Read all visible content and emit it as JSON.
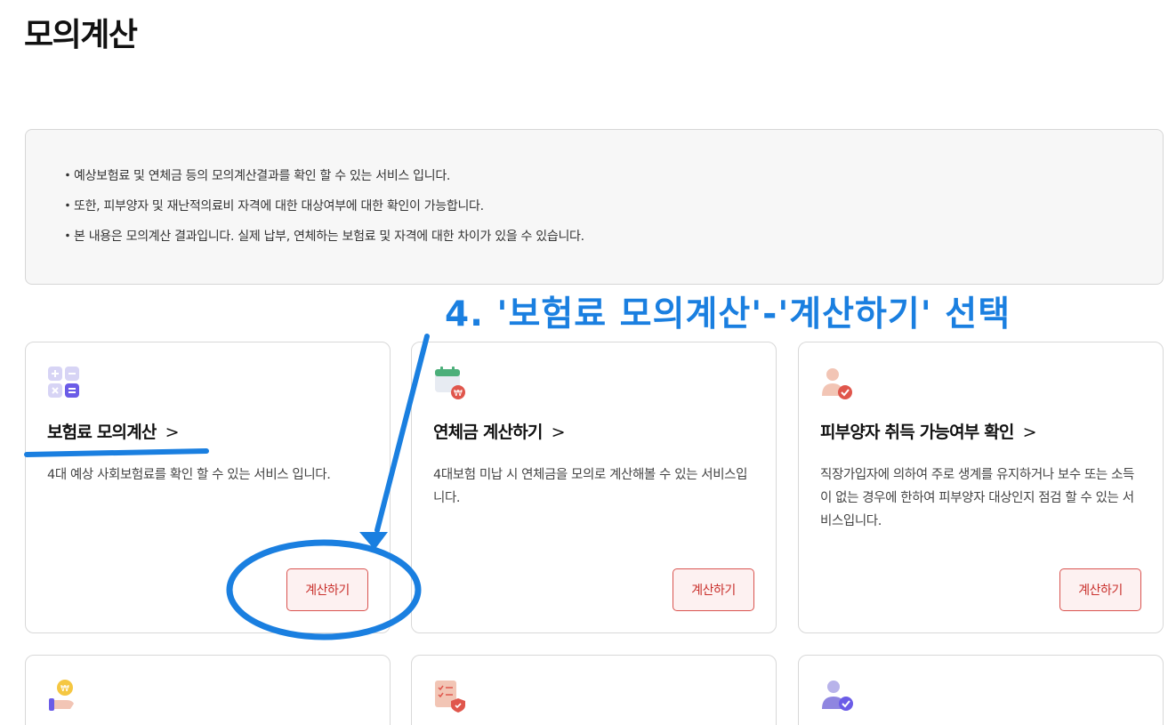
{
  "page": {
    "title": "모의계산"
  },
  "info": {
    "bullet": "・",
    "lines": [
      "예상보험료 및 연체금 등의 모의계산결과를 확인 할 수 있는 서비스 입니다.",
      "또한, 피부양자 및 재난적의료비 자격에 대한 대상여부에 대한 확인이 가능합니다.",
      "본 내용은 모의계산 결과입니다. 실제 납부, 연체하는 보험료 및 자격에 대한 차이가 있을 수 있습니다."
    ]
  },
  "annotation": {
    "text": "4. '보험료 모의계산'-'계산하기' 선택",
    "color": "#1a7fe0"
  },
  "cards": [
    {
      "title": "보험료 모의계산",
      "chevron": ">",
      "description": "4대 예상 사회보험료를 확인 할 수 있는 서비스 입니다.",
      "button": "계산하기",
      "icon": "calculator-icon"
    },
    {
      "title": "연체금 계산하기",
      "chevron": ">",
      "description": "4대보험 미납 시 연체금을 모의로 계산해볼 수 있는 서비스입니다.",
      "button": "계산하기",
      "icon": "calendar-won-icon"
    },
    {
      "title": "피부양자 취득 가능여부 확인",
      "chevron": ">",
      "description": "직장가입자에 의하여 주로 생계를 유지하거나 보수 또는 소득이 없는 경우에 한하여 피부양자 대상인지 점검 할 수 있는 서비스입니다.",
      "button": "계산하기",
      "icon": "person-check-icon"
    }
  ],
  "cards_row2_icons": [
    "hand-coin-icon",
    "document-shield-icon",
    "user-check-icon"
  ],
  "colors": {
    "accent_red": "#c9302c",
    "annotation_blue": "#1a7fe0"
  }
}
